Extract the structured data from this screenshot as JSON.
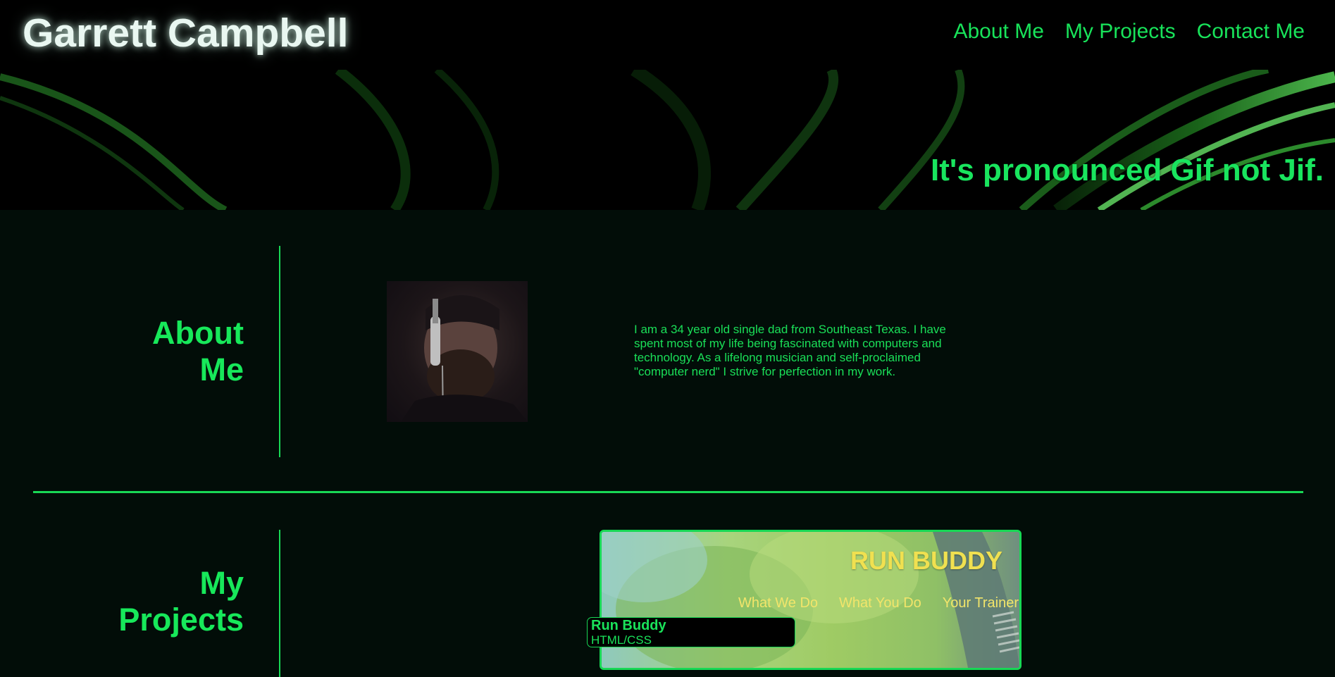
{
  "header": {
    "site_title": "Garrett Campbell",
    "nav": [
      "About Me",
      "My Projects",
      "Contact Me"
    ]
  },
  "hero": {
    "tagline": "It's pronounced Gif not Jif."
  },
  "about": {
    "heading_line1": "About",
    "heading_line2": "Me",
    "bio": "I am a 34 year old single dad from Southeast Texas. I have spent most of my life being fascinated with computers and technology. As a lifelong musician and self-proclaimed \"computer nerd\" I strive for perfection in my work."
  },
  "projects": {
    "heading_line1": "My",
    "heading_line2": "Projects",
    "items": [
      {
        "preview_title": "RUN BUDDY",
        "preview_nav": [
          "What We Do",
          "What You Do",
          "Your Trainer"
        ],
        "name": "Run Buddy",
        "tech": "HTML/CSS"
      }
    ]
  },
  "colors": {
    "accent": "#18e35a",
    "background": "#020d08",
    "header_bg": "#000000",
    "title_glow": "#e9f7f1",
    "run_buddy_yellow": "#f0e050"
  }
}
